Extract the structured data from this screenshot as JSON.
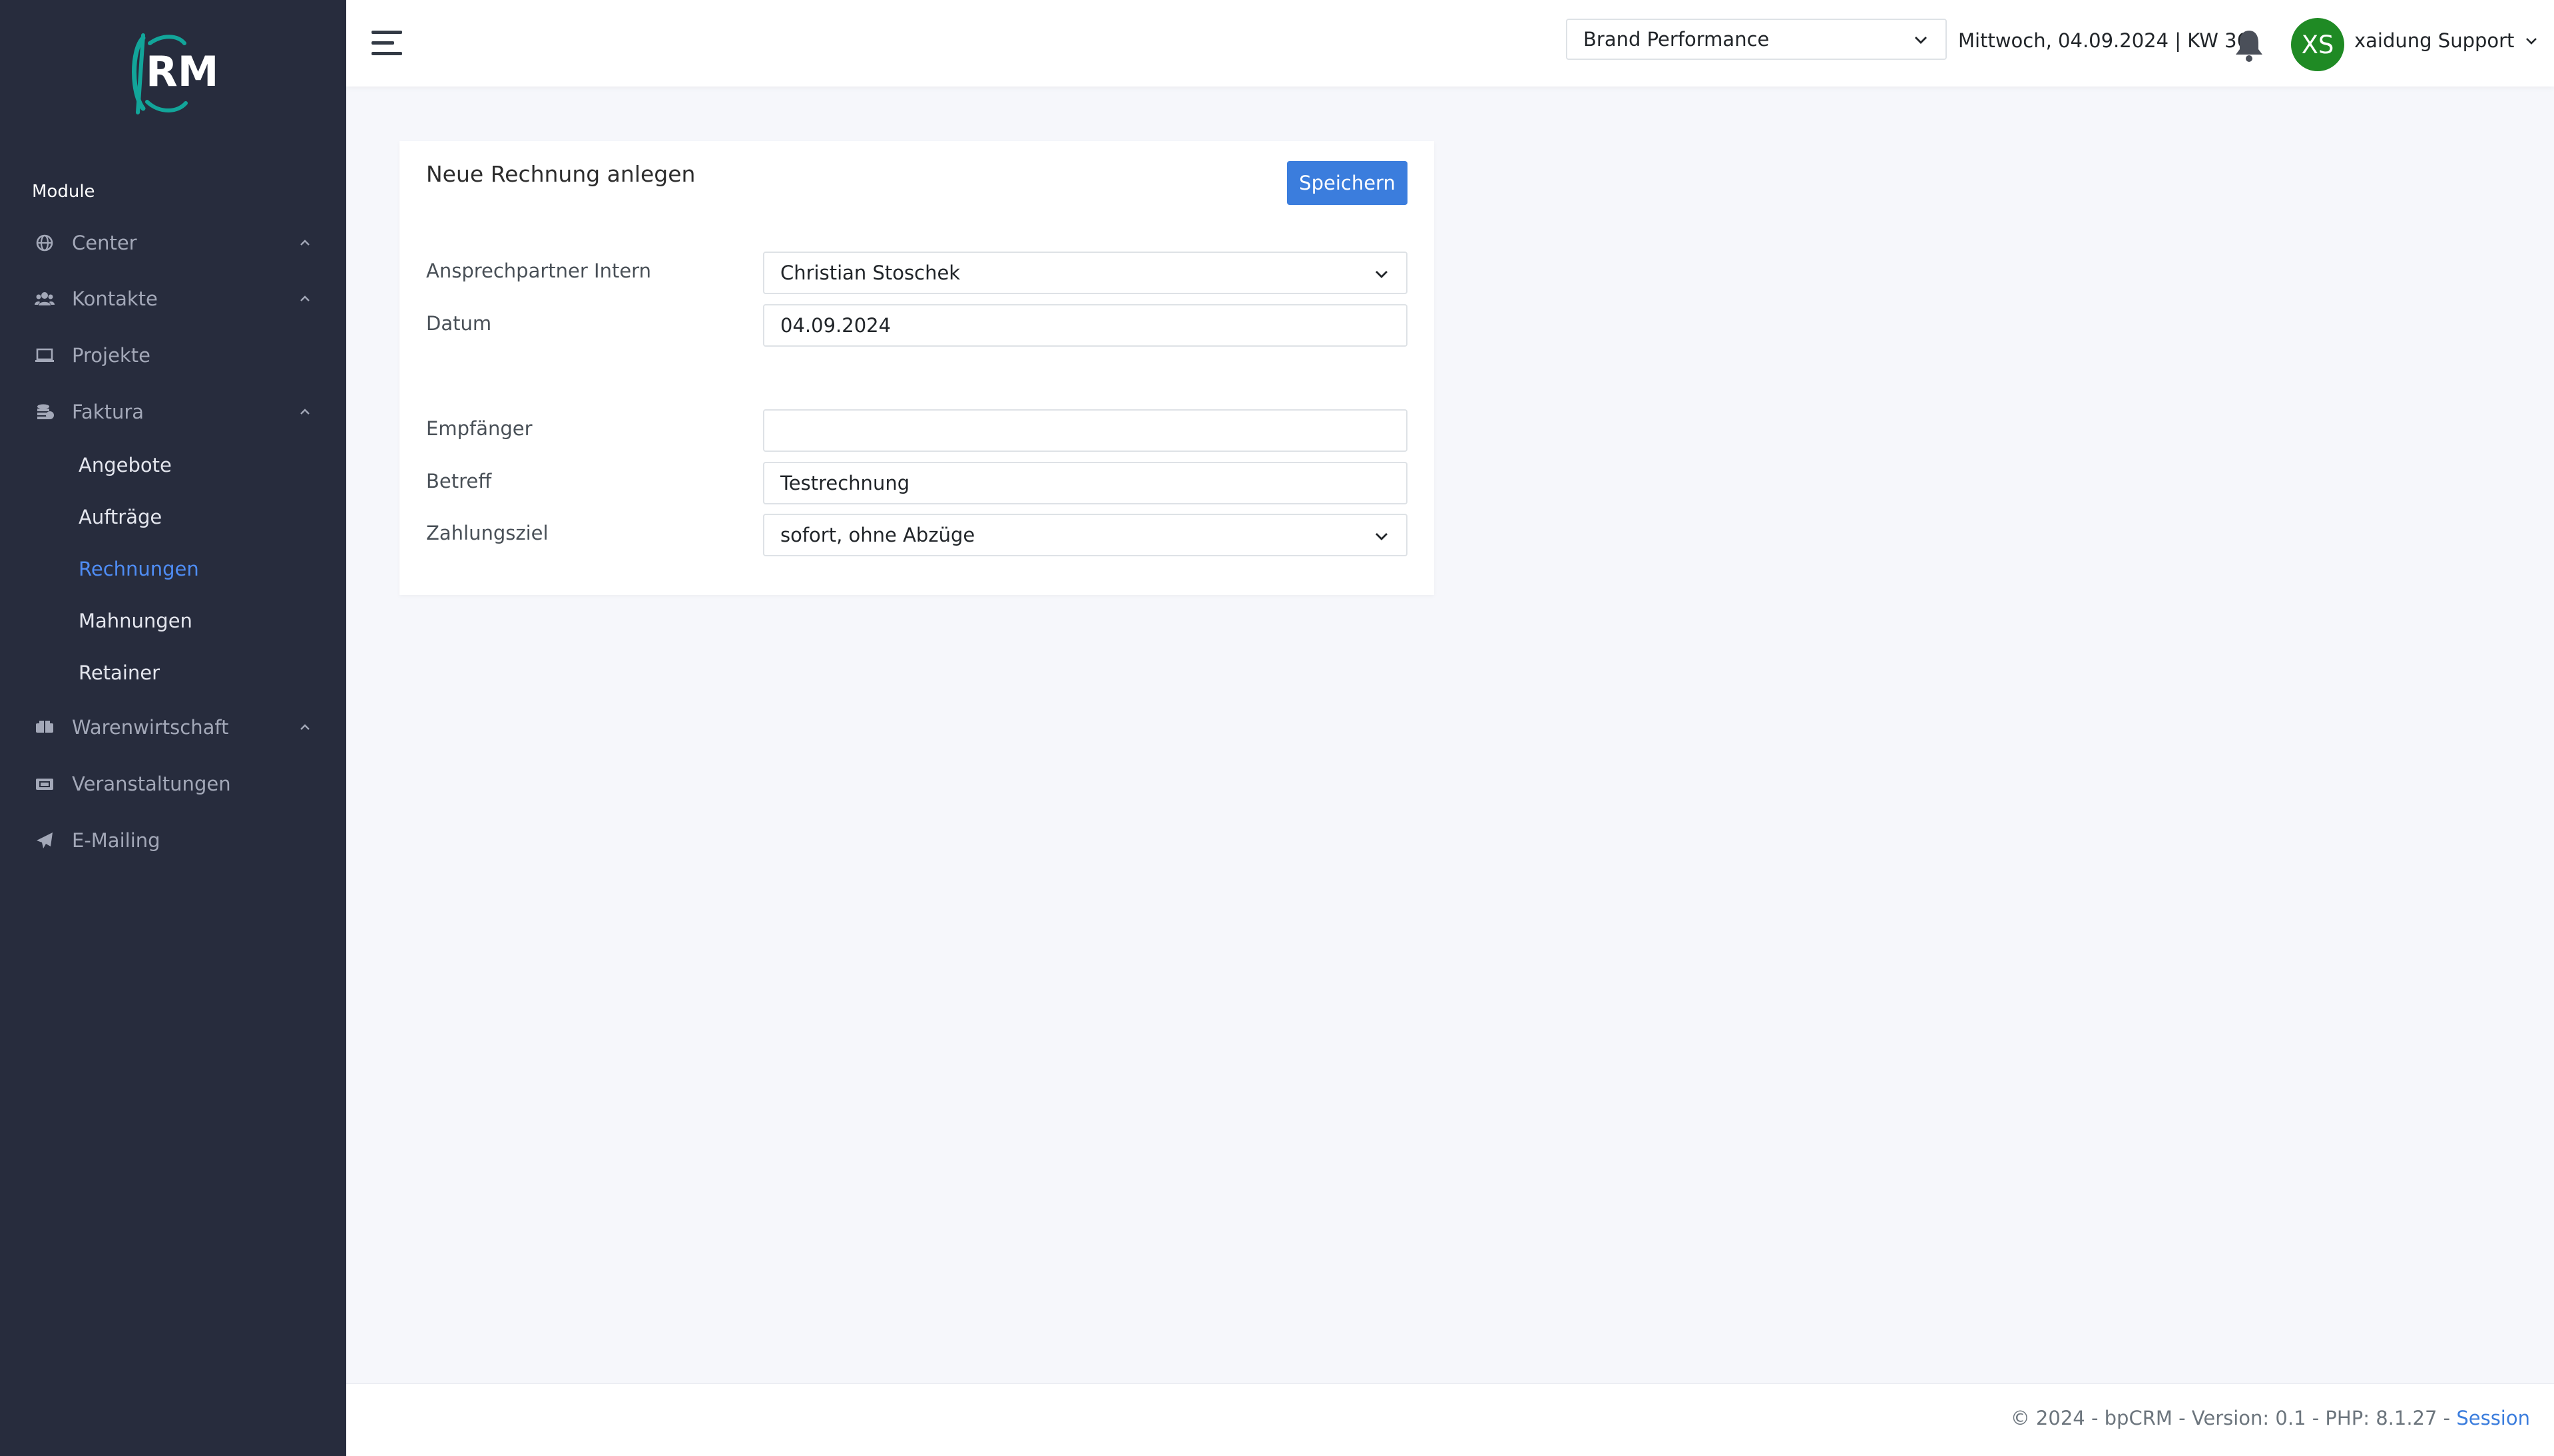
{
  "brand": {
    "logo_text": "RM"
  },
  "sidebar": {
    "section_heading": "Module",
    "items": [
      {
        "label": "Center",
        "icon": "globe-icon"
      },
      {
        "label": "Kontakte",
        "icon": "users-icon"
      },
      {
        "label": "Projekte",
        "icon": "laptop-icon"
      },
      {
        "label": "Faktura",
        "icon": "coins-icon"
      },
      {
        "label": "Warenwirtschaft",
        "icon": "boxes-icon"
      },
      {
        "label": "Veranstaltungen",
        "icon": "ticket-icon"
      },
      {
        "label": "E-Mailing",
        "icon": "paper-plane-icon"
      }
    ],
    "faktura_subitems": [
      {
        "label": "Angebote"
      },
      {
        "label": "Aufträge"
      },
      {
        "label": "Rechnungen",
        "active": true
      },
      {
        "label": "Mahnungen"
      },
      {
        "label": "Retainer"
      }
    ]
  },
  "header": {
    "workspace_select": "Brand Performance",
    "date_text": "Mittwoch, 04.09.2024 | KW 36",
    "avatar_initials": "XS",
    "user_name": "xaidung Support"
  },
  "form": {
    "title": "Neue Rechnung anlegen",
    "save_label": "Speichern",
    "fields": {
      "ansprechpartner": {
        "label": "Ansprechpartner Intern",
        "value": "Christian Stoschek"
      },
      "datum": {
        "label": "Datum",
        "value": "04.09.2024"
      },
      "empfaenger": {
        "label": "Empfänger",
        "value": ""
      },
      "betreff": {
        "label": "Betreff",
        "value": "Testrechnung"
      },
      "zahlungsziel": {
        "label": "Zahlungsziel",
        "value": "sofort, ohne Abzüge"
      }
    }
  },
  "footer": {
    "text": "© 2024 - bpCRM - Version: 0.1 - PHP: 8.1.27 - ",
    "link": "Session"
  },
  "colors": {
    "sidebar_bg": "#272c3d",
    "accent": "#3b7ddd",
    "active_link": "#4f8df5",
    "avatar_bg": "#1f8a24",
    "logo_teal": "#12a59a"
  }
}
